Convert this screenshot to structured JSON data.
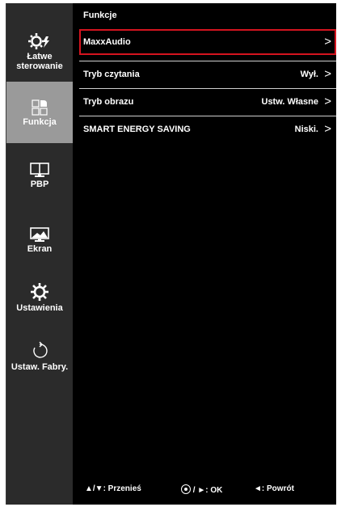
{
  "sidebar": {
    "items": [
      {
        "label": "Łatwe sterowanie",
        "icon": "gear-lightning-icon"
      },
      {
        "label": "Funkcja",
        "icon": "grid-quadrant-icon",
        "active": true
      },
      {
        "label": "PBP",
        "icon": "split-screen-icon"
      },
      {
        "label": "Ekran",
        "icon": "picture-icon"
      },
      {
        "label": "Ustawienia",
        "icon": "gear-icon"
      },
      {
        "label": "Ustaw. Fabry.",
        "icon": "reset-arrow-icon"
      }
    ]
  },
  "main": {
    "title": "Funkcje",
    "rows": [
      {
        "name": "MaxxAudio",
        "value": "",
        "arrow": ">",
        "selected": true
      },
      {
        "name": "Tryb czytania",
        "value": "Wył.",
        "arrow": ">"
      },
      {
        "name": "Tryb obrazu",
        "value": "Ustw. Własne",
        "arrow": ">"
      },
      {
        "name": "SMART ENERGY SAVING",
        "value": "Niski.",
        "arrow": ">"
      }
    ]
  },
  "footer": {
    "move": "▲/▼: Przenieś",
    "ok_symbol": "/ ►: OK",
    "back": "◄: Powrót"
  },
  "colors": {
    "selection_border": "#d4141f",
    "active_sidebar": "#9a9a9a",
    "sidebar_bg": "#2b2b2b"
  }
}
